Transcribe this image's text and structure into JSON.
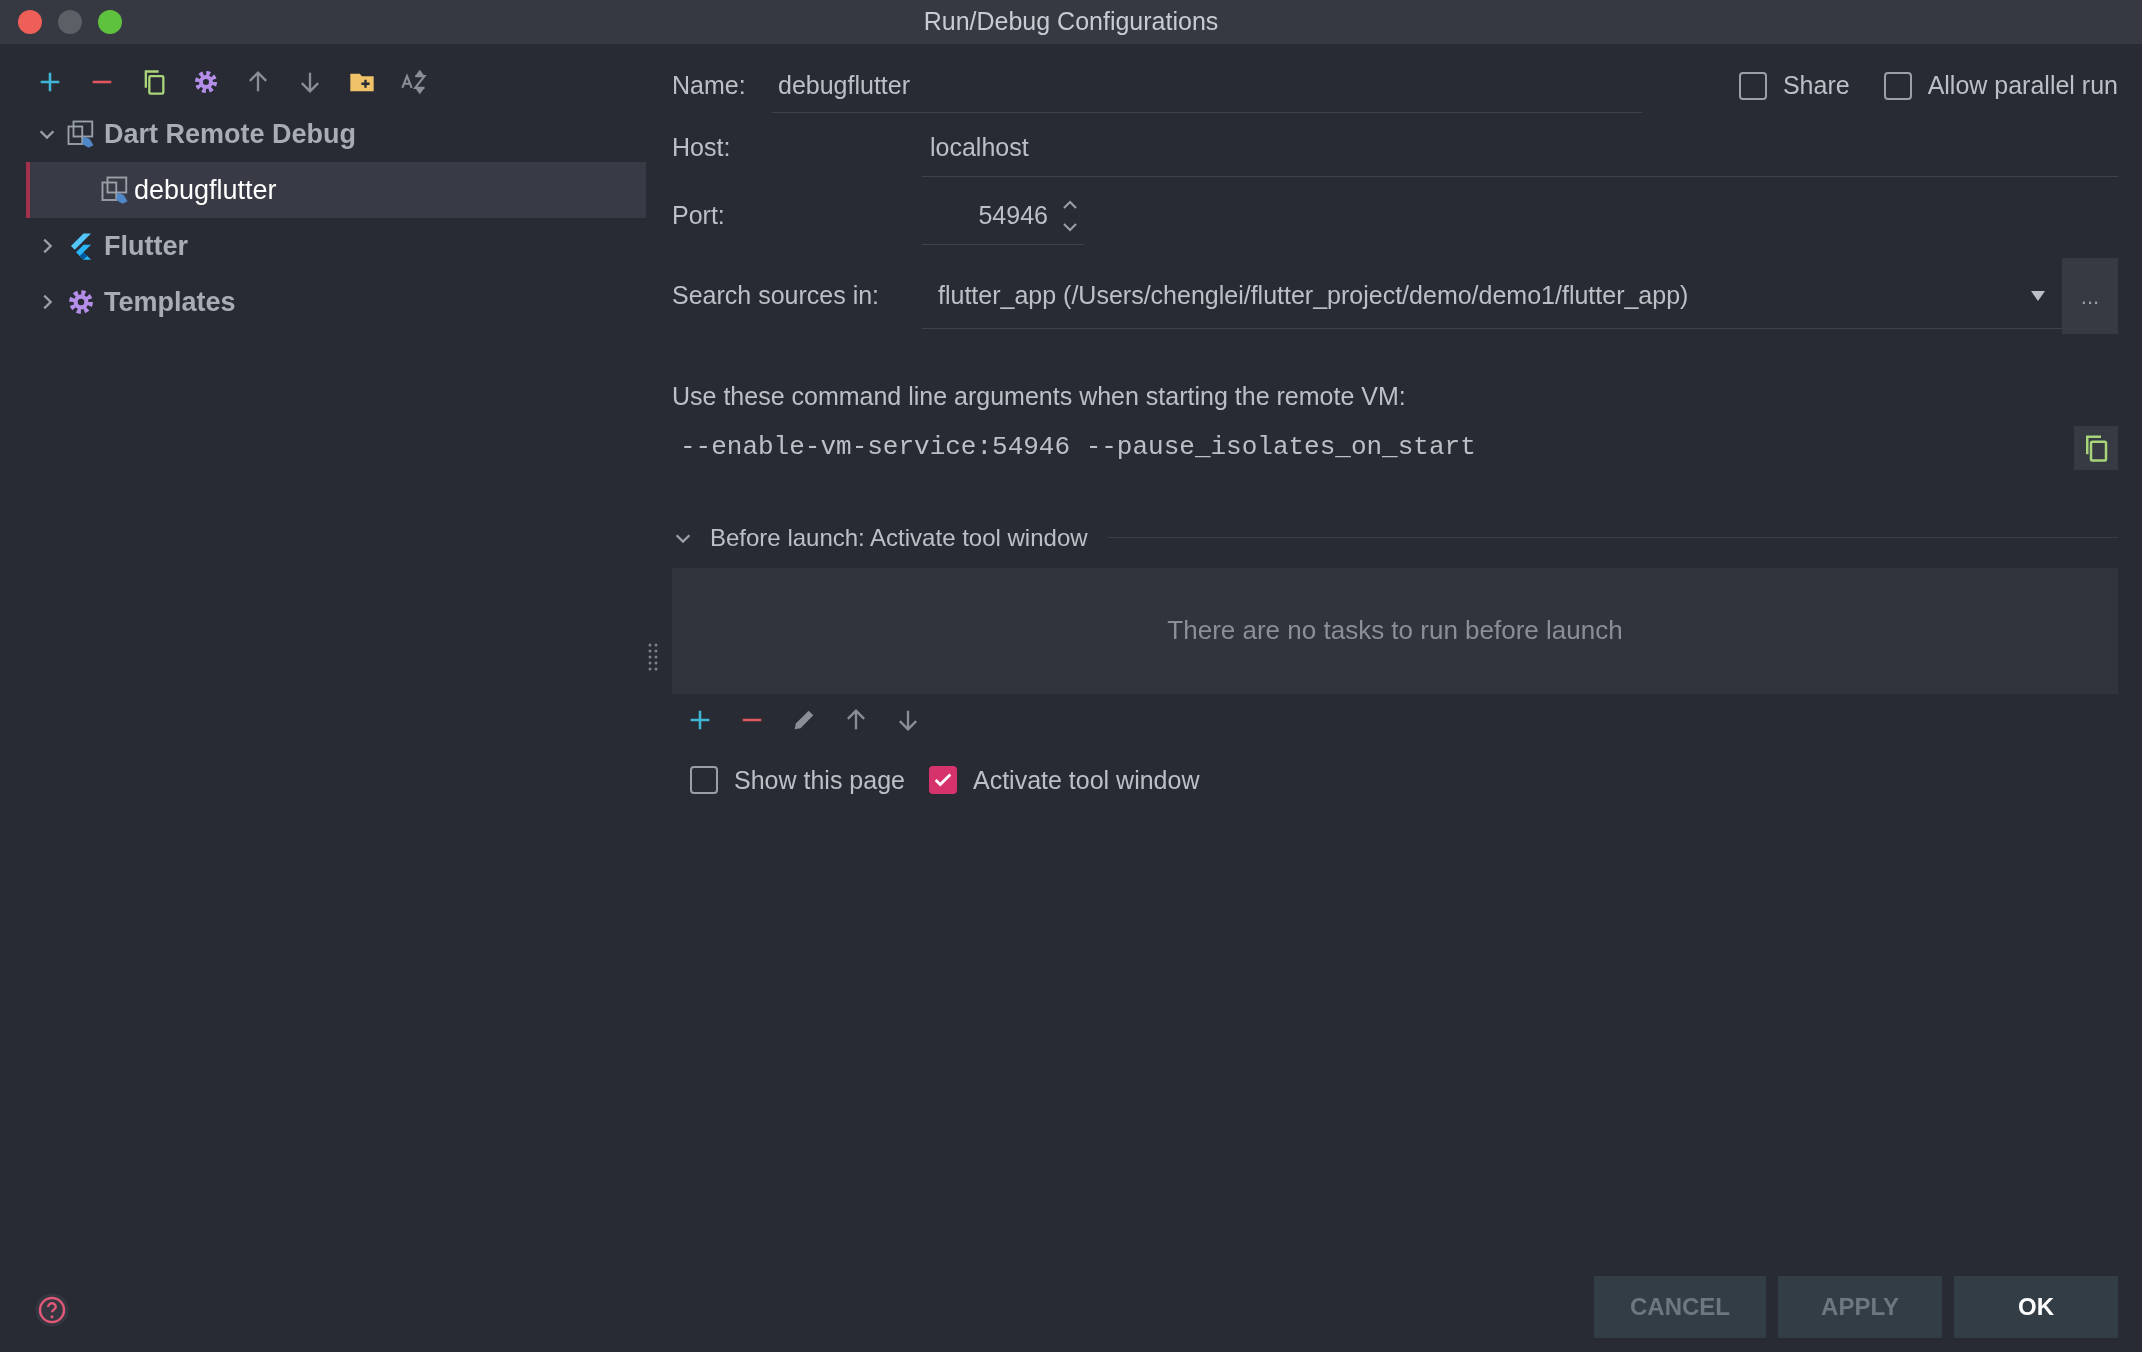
{
  "window": {
    "title": "Run/Debug Configurations"
  },
  "toolbar": [
    {
      "kind": "add"
    },
    {
      "kind": "remove"
    },
    {
      "kind": "copy"
    },
    {
      "kind": "settings"
    },
    {
      "kind": "up"
    },
    {
      "kind": "down"
    },
    {
      "kind": "folder"
    },
    {
      "kind": "sort"
    }
  ],
  "tree": [
    {
      "label": "Dart Remote Debug",
      "kind": "dart",
      "expanded": true,
      "children": [
        {
          "label": "debugflutter",
          "kind": "dart",
          "selected": true
        }
      ]
    },
    {
      "label": "Flutter",
      "kind": "flutter",
      "expanded": false
    },
    {
      "label": "Templates",
      "kind": "gear",
      "expanded": false
    }
  ],
  "form": {
    "name_label": "Name:",
    "name_value": "debugflutter",
    "options": [
      {
        "label": "Share",
        "checked": false
      },
      {
        "label": "Allow parallel run",
        "checked": false
      }
    ],
    "host_label": "Host:",
    "host_value": "localhost",
    "port_label": "Port:",
    "port_value": "54946",
    "sources_label": "Search sources in:",
    "sources_value": "flutter_app (/Users/chenglei/flutter_project/demo/demo1/flutter_app)",
    "browse": "...",
    "args_label": "Use these command line arguments when starting the remote VM:",
    "args": "--enable-vm-service:54946 --pause_isolates_on_start"
  },
  "before_launch": {
    "title": "Before launch: Activate tool window",
    "expanded": true,
    "empty_text": "There are no tasks to run before launch",
    "toolbar": [
      {
        "kind": "add"
      },
      {
        "kind": "remove"
      },
      {
        "kind": "edit"
      },
      {
        "kind": "up"
      },
      {
        "kind": "down"
      }
    ],
    "options": [
      {
        "label": "Show this page",
        "checked": false
      },
      {
        "label": "Activate tool window",
        "checked": true
      }
    ]
  },
  "buttons": [
    {
      "label": "CANCEL",
      "primary": false
    },
    {
      "label": "APPLY",
      "primary": false
    },
    {
      "label": "OK",
      "primary": true
    }
  ]
}
